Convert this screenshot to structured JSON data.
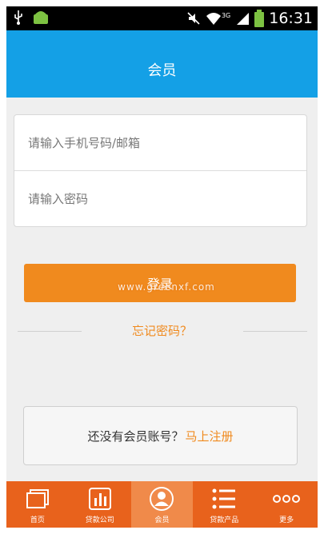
{
  "status_bar": {
    "time": "16:31",
    "network": "3G"
  },
  "header": {
    "title": "会员"
  },
  "form": {
    "account_placeholder": "请输入手机号码/邮箱",
    "password_placeholder": "请输入密码"
  },
  "login_button": {
    "label": "登录"
  },
  "watermark": {
    "text": "www.greenxf.com"
  },
  "forgot_link": {
    "label": "忘记密码？"
  },
  "register": {
    "question": "还没有会员账号？",
    "link": "马上注册"
  },
  "tabs": [
    {
      "label": "首页",
      "icon": "home-cards-icon",
      "active": false
    },
    {
      "label": "贷款公司",
      "icon": "bar-chart-icon",
      "active": false
    },
    {
      "label": "会员",
      "icon": "user-icon",
      "active": true
    },
    {
      "label": "贷款产品",
      "icon": "list-icon",
      "active": false
    },
    {
      "label": "更多",
      "icon": "more-dots-icon",
      "active": false
    }
  ],
  "colors": {
    "header": "#14a0e6",
    "accent": "#f08a1e",
    "tabbar": "#e8621c"
  }
}
